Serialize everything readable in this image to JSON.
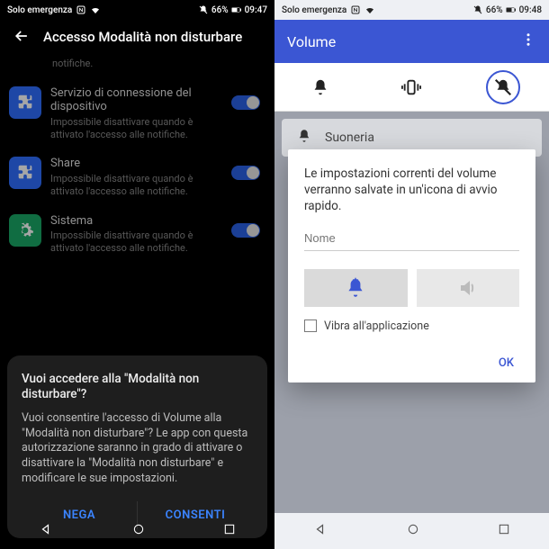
{
  "left": {
    "status": {
      "carrier": "Solo emergenza",
      "battery": "66%",
      "time": "09:47"
    },
    "header": "Accesso Modalità non disturbare",
    "notice_trail": "notifiche.",
    "items": [
      {
        "title": "Servizio di connessione del dispositivo",
        "sub": "Impossibile disattivare quando è attivato l'accesso alle notifiche.",
        "icon": "puzzle",
        "iconbg": "#2f6dff"
      },
      {
        "title": "Share",
        "sub": "Impossibile disattivare quando è attivato l'accesso alle notifiche.",
        "icon": "puzzle",
        "iconbg": "#2f6dff"
      },
      {
        "title": "Sistema",
        "sub": "Impossibile disattivare quando è attivato l'accesso alle notifiche.",
        "icon": "gear",
        "iconbg": "#1aa866"
      }
    ],
    "dialog": {
      "question": "Vuoi accedere alla \"Modalità non disturbare\"?",
      "body": "Vuoi consentire l'accesso di Volume alla \"Modalità non disturbare\"? Le app con questa autorizzazione saranno in grado di attivare o disattivare la \"Modalità non disturbare\" e modificare le sue impostazioni.",
      "deny": "NEGA",
      "allow": "CONSENTI"
    }
  },
  "right": {
    "status": {
      "carrier": "Solo emergenza",
      "battery": "66%",
      "time": "09:48"
    },
    "appbar": "Volume",
    "row1": "Suoneria",
    "dialog": {
      "msg": "Le impostazioni correnti del volume verranno salvate in un'icona di avvio rapido.",
      "placeholder": "Nome",
      "vibrate": "Vibra all'applicazione",
      "ok": "OK"
    }
  }
}
